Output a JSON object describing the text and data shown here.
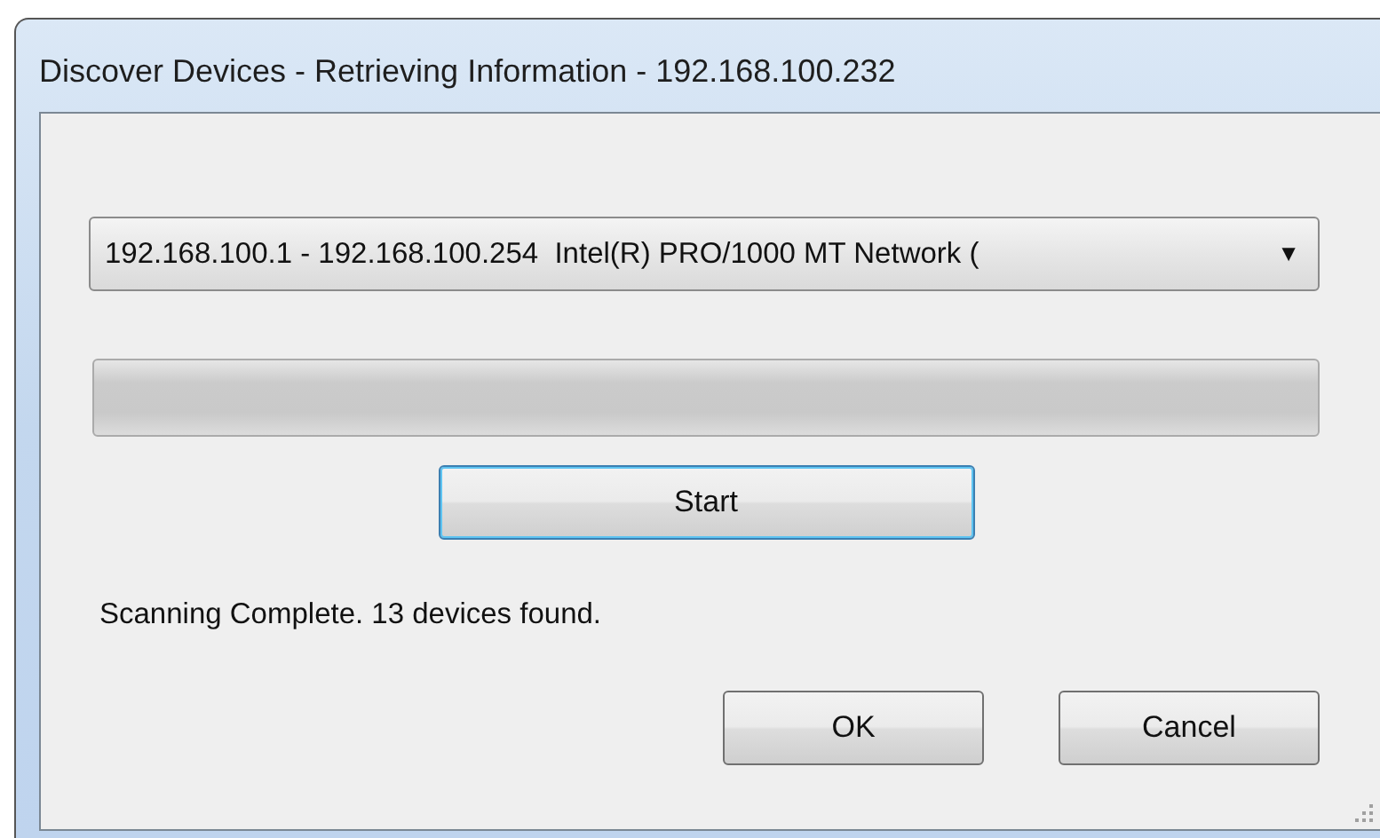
{
  "window": {
    "title": "Discover Devices - Retrieving Information - 192.168.100.232"
  },
  "range_dropdown": {
    "value": "192.168.100.1 - 192.168.100.254  Intel(R) PRO/1000 MT Network (",
    "arrow": "▼"
  },
  "progress": {
    "level": 0
  },
  "start_button": {
    "label": "Start",
    "focused": true
  },
  "status": "Scanning Complete. 13 devices found.",
  "buttons": [
    {
      "label": "OK"
    },
    {
      "label": "Cancel"
    }
  ]
}
